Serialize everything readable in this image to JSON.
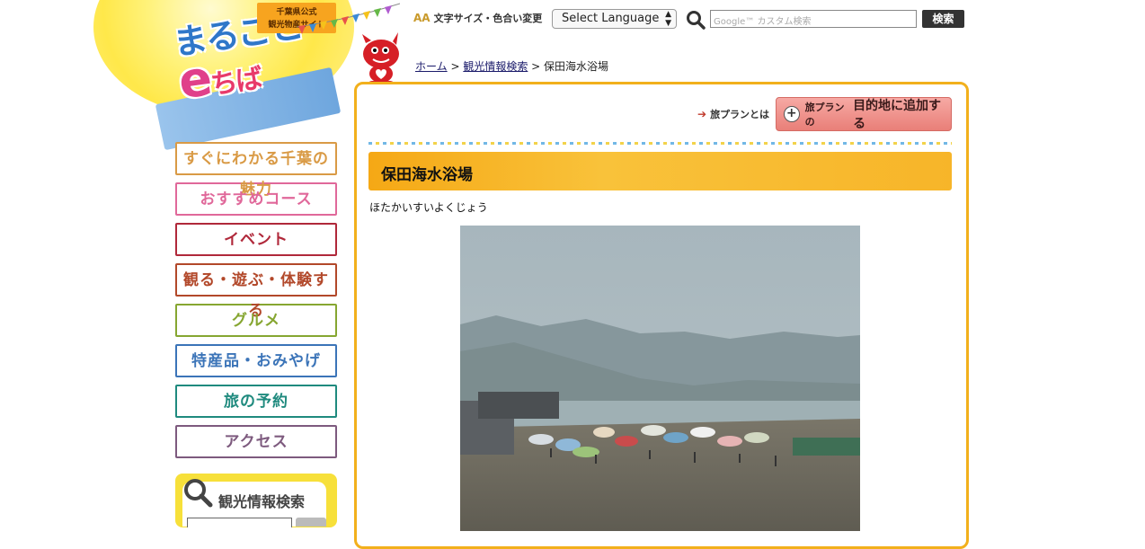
{
  "logo": {
    "official_line1": "千葉県公式",
    "official_line2": "観光物産サイト",
    "title_part1": "まるごと",
    "title_e": "e",
    "title_part2": "ちば"
  },
  "tools": {
    "font_size_label": "文字サイズ・色合い変更",
    "font_size_icon": "AA",
    "language_select": "Select Language",
    "search_placeholder": "Google™ カスタム検索",
    "search_button": "検索"
  },
  "breadcrumb": {
    "home": "ホーム",
    "sep1": " > ",
    "search": "観光情報検索",
    "sep2": " > ",
    "current": "保田海水浴場"
  },
  "nav": {
    "items": [
      {
        "label": "すぐにわかる千葉の魅力",
        "color": "#d99a45"
      },
      {
        "label": "おすすめコース",
        "color": "#e0689a"
      },
      {
        "label": "イベント",
        "color": "#b0283a"
      },
      {
        "label": "観る・遊ぶ・体験する",
        "color": "#b2482a"
      },
      {
        "label": "グルメ",
        "color": "#86a631"
      },
      {
        "label": "特産品・おみやげ",
        "color": "#3b74b8"
      },
      {
        "label": "旅の予約",
        "color": "#1f8a7e"
      },
      {
        "label": "アクセス",
        "color": "#7d5a7e"
      }
    ]
  },
  "side_search": {
    "label": "観光情報検索"
  },
  "plan": {
    "what_is": "旅プランとは",
    "add_small": "旅プランの",
    "add_label": "目的地に追加する"
  },
  "spot": {
    "title": "保田海水浴場",
    "reading": "ほたかいすいよくじょう"
  },
  "colors": {
    "accent": "#f2b01c",
    "title_bar": "#f5a815",
    "add_button": "#e97f78"
  }
}
